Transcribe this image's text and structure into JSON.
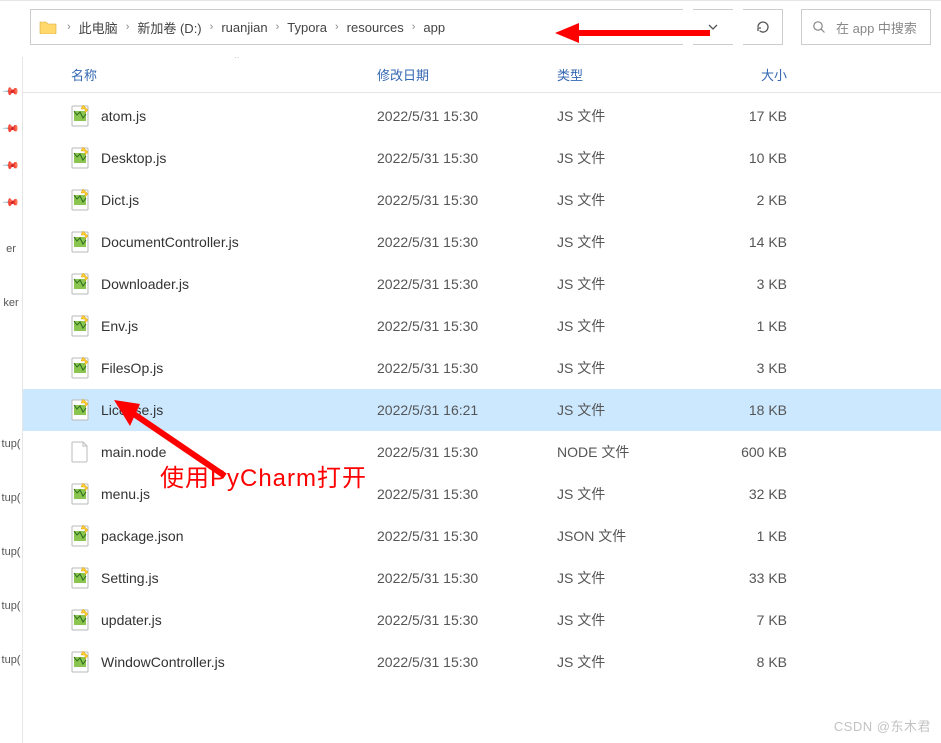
{
  "breadcrumb": [
    "此电脑",
    "新加卷 (D:)",
    "ruanjian",
    "Typora",
    "resources",
    "app"
  ],
  "search": {
    "placeholder": "在 app 中搜索"
  },
  "columns": {
    "name": "名称",
    "date": "修改日期",
    "type": "类型",
    "size": "大小"
  },
  "files": [
    {
      "name": "atom.js",
      "date": "2022/5/31 15:30",
      "type": "JS 文件",
      "size": "17 KB",
      "icon": "js",
      "selected": false
    },
    {
      "name": "Desktop.js",
      "date": "2022/5/31 15:30",
      "type": "JS 文件",
      "size": "10 KB",
      "icon": "js",
      "selected": false
    },
    {
      "name": "Dict.js",
      "date": "2022/5/31 15:30",
      "type": "JS 文件",
      "size": "2 KB",
      "icon": "js",
      "selected": false
    },
    {
      "name": "DocumentController.js",
      "date": "2022/5/31 15:30",
      "type": "JS 文件",
      "size": "14 KB",
      "icon": "js",
      "selected": false
    },
    {
      "name": "Downloader.js",
      "date": "2022/5/31 15:30",
      "type": "JS 文件",
      "size": "3 KB",
      "icon": "js",
      "selected": false
    },
    {
      "name": "Env.js",
      "date": "2022/5/31 15:30",
      "type": "JS 文件",
      "size": "1 KB",
      "icon": "js",
      "selected": false
    },
    {
      "name": "FilesOp.js",
      "date": "2022/5/31 15:30",
      "type": "JS 文件",
      "size": "3 KB",
      "icon": "js",
      "selected": false
    },
    {
      "name": "License.js",
      "date": "2022/5/31 16:21",
      "type": "JS 文件",
      "size": "18 KB",
      "icon": "js",
      "selected": true
    },
    {
      "name": "main.node",
      "date": "2022/5/31 15:30",
      "type": "NODE 文件",
      "size": "600 KB",
      "icon": "blank",
      "selected": false
    },
    {
      "name": "menu.js",
      "date": "2022/5/31 15:30",
      "type": "JS 文件",
      "size": "32 KB",
      "icon": "js",
      "selected": false
    },
    {
      "name": "package.json",
      "date": "2022/5/31 15:30",
      "type": "JSON 文件",
      "size": "1 KB",
      "icon": "js",
      "selected": false
    },
    {
      "name": "Setting.js",
      "date": "2022/5/31 15:30",
      "type": "JS 文件",
      "size": "33 KB",
      "icon": "js",
      "selected": false
    },
    {
      "name": "updater.js",
      "date": "2022/5/31 15:30",
      "type": "JS 文件",
      "size": "7 KB",
      "icon": "js",
      "selected": false
    },
    {
      "name": "WindowController.js",
      "date": "2022/5/31 15:30",
      "type": "JS 文件",
      "size": "8 KB",
      "icon": "js",
      "selected": false
    }
  ],
  "sidebar_items": [
    "er",
    "ker",
    "tup(",
    "tup(",
    "tup(",
    "tup(",
    "tup("
  ],
  "annotation": "使用PyCharm打开",
  "watermark": "CSDN @东木君"
}
